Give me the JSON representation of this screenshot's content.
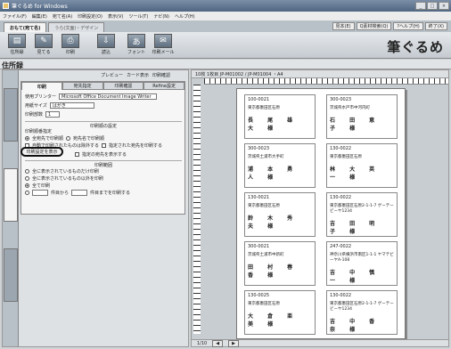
{
  "window": {
    "title": "筆ぐるめ for Windows"
  },
  "menu": [
    "ファイル(F)",
    "編集(E)",
    "宛て名(A)",
    "印刷設定(O)",
    "表示(V)",
    "ツール(T)",
    "ナビ(N)",
    "ヘルプ(H)"
  ],
  "tabs": [
    "おもて(宛て名)",
    "うら(文面)・デザイン"
  ],
  "topright_buttons": [
    "見本(E)",
    "Q素材検索(Q)",
    "?ヘルプ(H)",
    "終了(X)"
  ],
  "ribbon": [
    {
      "label": "住所録",
      "icon": "book-icon"
    },
    {
      "label": "見てる",
      "icon": "view-icon"
    },
    {
      "label": "印刷",
      "icon": "printer-icon"
    },
    {
      "label": "読込",
      "icon": "import-icon"
    },
    {
      "label": "フォント",
      "icon": "font-icon"
    },
    {
      "label": "印刷メール",
      "icon": "mail-icon"
    }
  ],
  "logo": "筆ぐるめ",
  "page_title": "住所録",
  "preview_toggles": [
    "プレビュー",
    "カード表示",
    "印刷確認"
  ],
  "panel": {
    "tabs": [
      "印刷",
      "宛先指定",
      "印刷確認",
      "Refine設定"
    ],
    "printer_label": "使用プリンター",
    "printer_value": "Microsoft Office Document Image Writer",
    "paper_label": "用紙サイズ",
    "paper_value": "はがき",
    "copies_label": "印刷部数",
    "copies_value": "1",
    "section_print_order": "印刷順の設定",
    "order_label": "印刷順番指定",
    "radio_order_1": "全宛先で印刷順",
    "radio_order_2": "宛先名で印刷順",
    "check_1": "自動で印刷されたものは除外する",
    "check_2": "指定された宛先を印刷する",
    "highlight_button": "印刷設定を表示",
    "check_3": "指定の宛先を表示する",
    "section_range": "印刷範囲",
    "range_1": "全に表示されているものだけ印刷",
    "range_2": "全に表示されているもの以外を印刷",
    "range_3": "全て印刷",
    "range_4_a": "件目から",
    "range_4_b": "件目までを印刷する"
  },
  "preview": {
    "bar": "10枚 1枚目 JP-M01002 / JP-M01004 ・A4",
    "status": "1/10"
  },
  "cards": [
    {
      "zip": "100-0021",
      "addr": "東京都墨田区石原",
      "name": "長 尾 雄 大 様"
    },
    {
      "zip": "300-0023",
      "addr": "茨城県水戸市中河内町",
      "name": "石 田 恵 子 様"
    },
    {
      "zip": "300-0023",
      "addr": "茨城県土浦市大手町",
      "name": "浦 本 勇 人 様"
    },
    {
      "zip": "130-0022",
      "addr": "東京都墨田区石原",
      "name": "林 大 英 一 様"
    },
    {
      "zip": "130-0021",
      "addr": "東京都墨田区石原",
      "name": "鈴 木 秀 夫 様"
    },
    {
      "zip": "130-0022",
      "addr": "東京都墨田区石原2-1-1-7 ゲーテービーヤ1234",
      "name": "吉 田 明 子 様"
    },
    {
      "zip": "300-0021",
      "addr": "茨城県土浦市中新町",
      "name": "田 村 春 香 様"
    },
    {
      "zip": "247-0022",
      "addr": "神奈川県横浜市南区1-1-1 ヤマテビーヤA-108",
      "name": "吉 中 慎 一 様"
    },
    {
      "zip": "130-0025",
      "addr": "東京都墨田区石原",
      "name": "大 倉 亜 美 様"
    },
    {
      "zip": "130-0022",
      "addr": "東京都墨田区石原2-1-1-7 ゲーテービーヤ1234",
      "name": "吉 中 香 奈 様"
    }
  ]
}
